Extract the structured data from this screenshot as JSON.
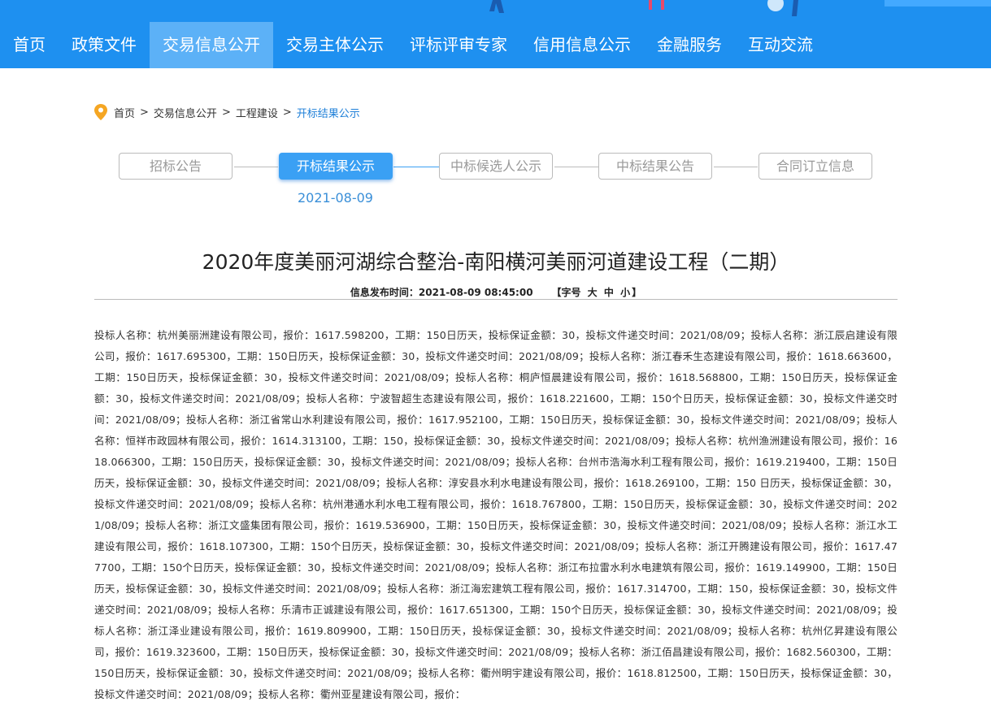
{
  "nav": {
    "items": [
      "首页",
      "政策文件",
      "交易信息公开",
      "交易主体公示",
      "评标评审专家",
      "信用信息公示",
      "金融服务",
      "互动交流"
    ],
    "active_index": 2
  },
  "breadcrumb": {
    "items": [
      "首页",
      "交易信息公开",
      "工程建设"
    ],
    "current": "开标结果公示",
    "separator": ">"
  },
  "steps": {
    "items": [
      "招标公告",
      "开标结果公示",
      "中标候选人公示",
      "中标结果公告",
      "合同订立信息"
    ],
    "active_index": 1,
    "active_date": "2021-08-09"
  },
  "article": {
    "title": "2020年度美丽河湖综合整治-南阳横河美丽河道建设工程（二期）",
    "publish_label": "信息发布时间：",
    "publish_time": "2021-08-09 08:45:00",
    "font_size_open": "【字号",
    "font_large": "大",
    "font_medium": "中",
    "font_small": "小",
    "font_size_close": "】",
    "body": "投标人名称：杭州美丽洲建设有限公司，报价：1617.598200，工期：150日历天，投标保证金额：30，投标文件递交时间：2021/08/09；投标人名称：浙江辰启建设有限公司，报价：1617.695300，工期：150日历天，投标保证金额：30，投标文件递交时间：2021/08/09；投标人名称：浙江春禾生态建设有限公司，报价：1618.663600，工期：150日历天，投标保证金额：30，投标文件递交时间：2021/08/09；投标人名称：桐庐恒晨建设有限公司，报价：1618.568800，工期：150日历天，投标保证金额：30，投标文件递交时间：2021/08/09；投标人名称：宁波智超生态建设有限公司，报价：1618.221600，工期：150个日历天，投标保证金额：30，投标文件递交时间：2021/08/09；投标人名称：浙江省常山水利建设有限公司，报价：1617.952100，工期：150日历天，投标保证金额：30，投标文件递交时间：2021/08/09；投标人名称：恒祥市政园林有限公司，报价：1614.313100，工期：150，投标保证金额：30，投标文件递交时间：2021/08/09；投标人名称：杭州渔洲建设有限公司，报价：1618.066300，工期：150日历天，投标保证金额：30，投标文件递交时间：2021/08/09；投标人名称：台州市浩海水利工程有限公司，报价：1619.219400，工期：150日历天，投标保证金额：30，投标文件递交时间：2021/08/09；投标人名称：淳安县水利水电建设有限公司，报价：1618.269100，工期：150 日历天，投标保证金额：30，投标文件递交时间：2021/08/09；投标人名称：杭州港通水利水电工程有限公司，报价：1618.767800，工期：150日历天，投标保证金额：30，投标文件递交时间：2021/08/09；投标人名称：浙江文盛集团有限公司，报价：1619.536900，工期：150日历天，投标保证金额：30，投标文件递交时间：2021/08/09；投标人名称：浙江水工建设有限公司，报价：1618.107300，工期：150个日历天，投标保证金额：30，投标文件递交时间：2021/08/09；投标人名称：浙江开腾建设有限公司，报价：1617.477700，工期：150个日历天，投标保证金额：30，投标文件递交时间：2021/08/09；投标人名称：浙江布拉雷水利水电建筑有限公司，报价：1619.149900，工期：150日历天，投标保证金额：30，投标文件递交时间：2021/08/09；投标人名称：浙江海宏建筑工程有限公司，报价：1617.314700，工期：150，投标保证金额：30，投标文件递交时间：2021/08/09；投标人名称：乐清市正诚建设有限公司，报价：1617.651300，工期：150个日历天，投标保证金额：30，投标文件递交时间：2021/08/09；投标人名称：浙江泽业建设有限公司，报价：1619.809900，工期：150日历天，投标保证金额：30，投标文件递交时间：2021/08/09；投标人名称：杭州亿昇建设有限公司，报价：1619.323600，工期：150日历天，投标保证金额：30，投标文件递交时间：2021/08/09；投标人名称：浙江佰昌建设有限公司，报价：1682.560300，工期：150日历天，投标保证金额：30，投标文件递交时间：2021/08/09；投标人名称：衢州明宇建设有限公司，报价：1618.812500，工期：150日历天，投标保证金额：30，投标文件递交时间：2021/08/09；投标人名称：衢州亚星建设有限公司，报价："
  },
  "colors": {
    "nav_bg": "#1e90f0",
    "nav_active": "#5cb1f7",
    "step_active": "#3aa0f4",
    "link": "#1e7fd8"
  }
}
